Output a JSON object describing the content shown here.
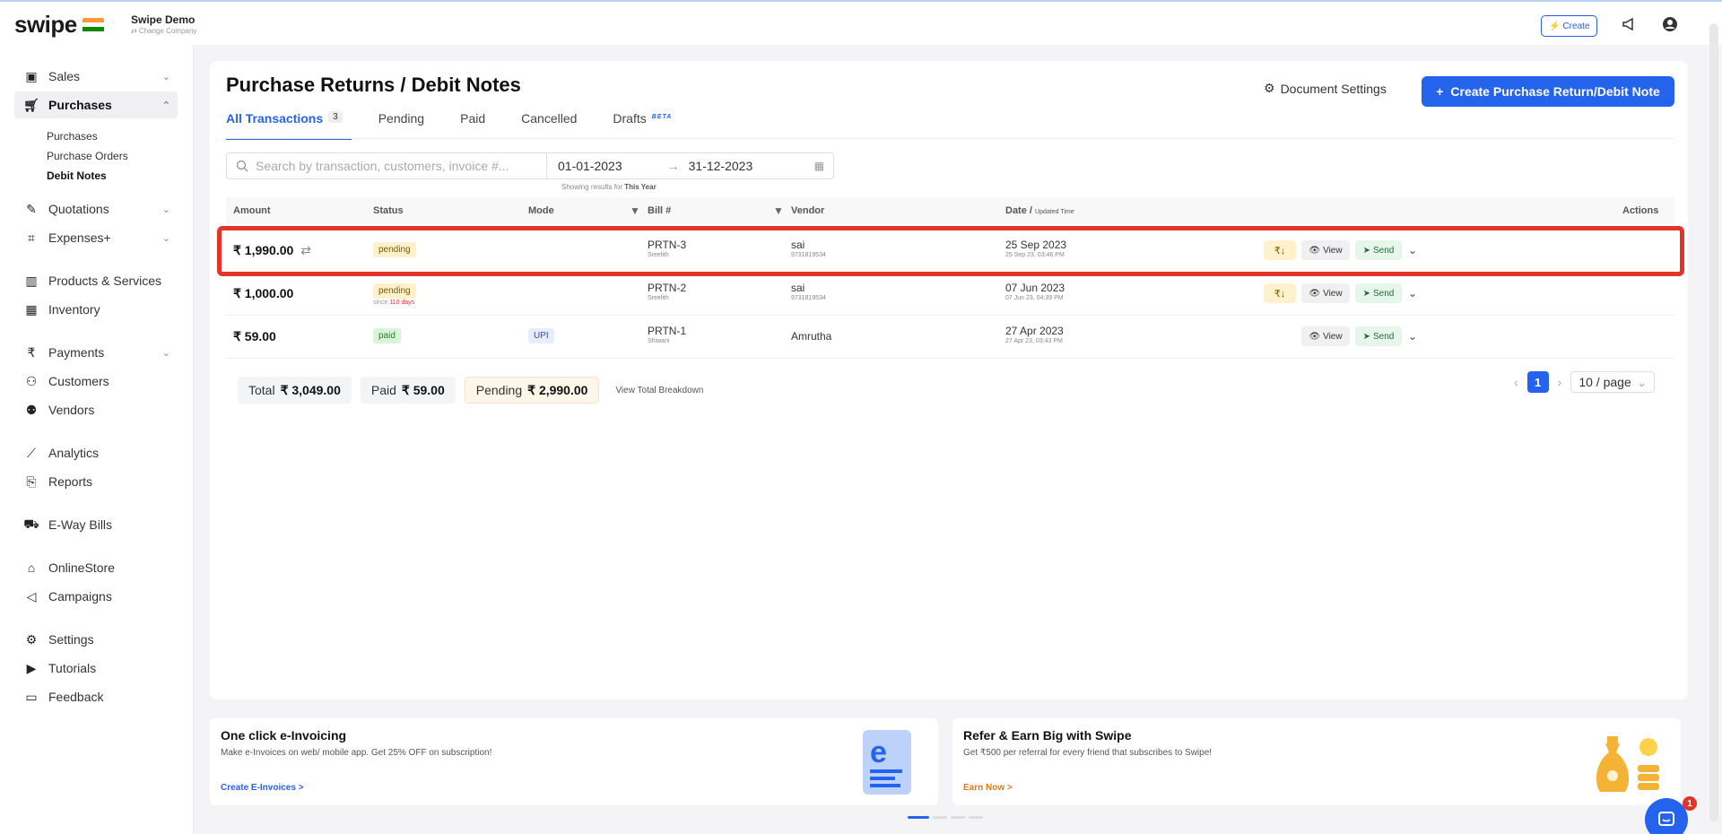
{
  "header": {
    "logo": "swipe",
    "company_name": "Swipe Demo",
    "change_company": "⇄ Change Company",
    "create_label": "Create"
  },
  "sidebar": {
    "items": [
      {
        "label": "Sales",
        "icon": "sales-icon"
      },
      {
        "label": "Purchases",
        "icon": "cart-icon"
      },
      {
        "label": "Quotations",
        "icon": "pen-icon"
      },
      {
        "label": "Expenses+",
        "icon": "tag-icon"
      },
      {
        "label": "Products & Services",
        "icon": "barcode-icon"
      },
      {
        "label": "Inventory",
        "icon": "inventory-icon"
      },
      {
        "label": "Payments",
        "icon": "rupee-icon"
      },
      {
        "label": "Customers",
        "icon": "user-icon"
      },
      {
        "label": "Vendors",
        "icon": "users-icon"
      },
      {
        "label": "Analytics",
        "icon": "chart-icon"
      },
      {
        "label": "Reports",
        "icon": "report-icon"
      },
      {
        "label": "E-Way Bills",
        "icon": "truck-icon"
      },
      {
        "label": "OnlineStore",
        "icon": "store-icon"
      },
      {
        "label": "Campaigns",
        "icon": "megaphone-icon"
      },
      {
        "label": "Settings",
        "icon": "gear-icon"
      },
      {
        "label": "Tutorials",
        "icon": "youtube-icon"
      },
      {
        "label": "Feedback",
        "icon": "feedback-icon"
      }
    ],
    "sub_items": [
      "Purchases",
      "Purchase Orders",
      "Debit Notes"
    ]
  },
  "page": {
    "title": "Purchase Returns / Debit Notes",
    "doc_settings": "Document Settings",
    "primary_action": "Create Purchase Return/Debit Note",
    "tabs": [
      {
        "label": "All Transactions",
        "count": "3"
      },
      {
        "label": "Pending"
      },
      {
        "label": "Paid"
      },
      {
        "label": "Cancelled"
      },
      {
        "label": "Drafts",
        "badge": "BETA"
      }
    ],
    "search_placeholder": "Search by transaction, customers, invoice #...",
    "date_from": "01-01-2023",
    "date_to": "31-12-2023",
    "showing_prefix": "Showing results for",
    "showing_period": "This Year"
  },
  "table": {
    "headers": {
      "amount": "Amount",
      "status": "Status",
      "mode": "Mode",
      "bill": "Bill #",
      "vendor": "Vendor",
      "date": "Date /",
      "date_sub": "Updated Time",
      "actions": "Actions"
    },
    "rows": [
      {
        "amount": "₹ 1,990.00",
        "status": "pending",
        "since": "",
        "mode": "",
        "bill": "PRTN-3",
        "bill_by": "Sreelith",
        "vendor": "sai",
        "vendor_phone": "9731819534",
        "date": "25 Sep 2023",
        "updated": "25 Sep 23, 03:46 PM"
      },
      {
        "amount": "₹ 1,000.00",
        "status": "pending",
        "since_prefix": "since",
        "since_value": "110 days",
        "mode": "",
        "bill": "PRTN-2",
        "bill_by": "Sreelith",
        "vendor": "sai",
        "vendor_phone": "9731819534",
        "date": "07 Jun 2023",
        "updated": "07 Jun 23, 04:39 PM"
      },
      {
        "amount": "₹ 59.00",
        "status": "paid",
        "since": "",
        "mode": "UPI",
        "bill": "PRTN-1",
        "bill_by": "Shiwani",
        "vendor": "Amrutha",
        "vendor_phone": "",
        "date": "27 Apr 2023",
        "updated": "27 Apr 23, 03:43 PM"
      }
    ],
    "actions": {
      "download": "₹↓",
      "view": "View",
      "send": "Send"
    }
  },
  "totals": {
    "total_label": "Total",
    "total_value": "₹ 3,049.00",
    "paid_label": "Paid",
    "paid_value": "₹ 59.00",
    "pending_label": "Pending",
    "pending_value": "₹ 2,990.00",
    "breakdown": "View Total Breakdown"
  },
  "pagination": {
    "current": "1",
    "page_size": "10 / page"
  },
  "promos": [
    {
      "title": "One click e-Invoicing",
      "desc": "Make e-Invoices on web/ mobile app. Get 25% OFF on subscription!",
      "link": "Create E-Invoices >"
    },
    {
      "title": "Refer & Earn Big with Swipe",
      "desc": "Get ₹500 per referral for every friend that subscribes to Swipe!",
      "link": "Earn Now >"
    }
  ],
  "chat_badge": "1",
  "colors": {
    "accent": "#2463eb",
    "highlight": "#e4332a"
  }
}
